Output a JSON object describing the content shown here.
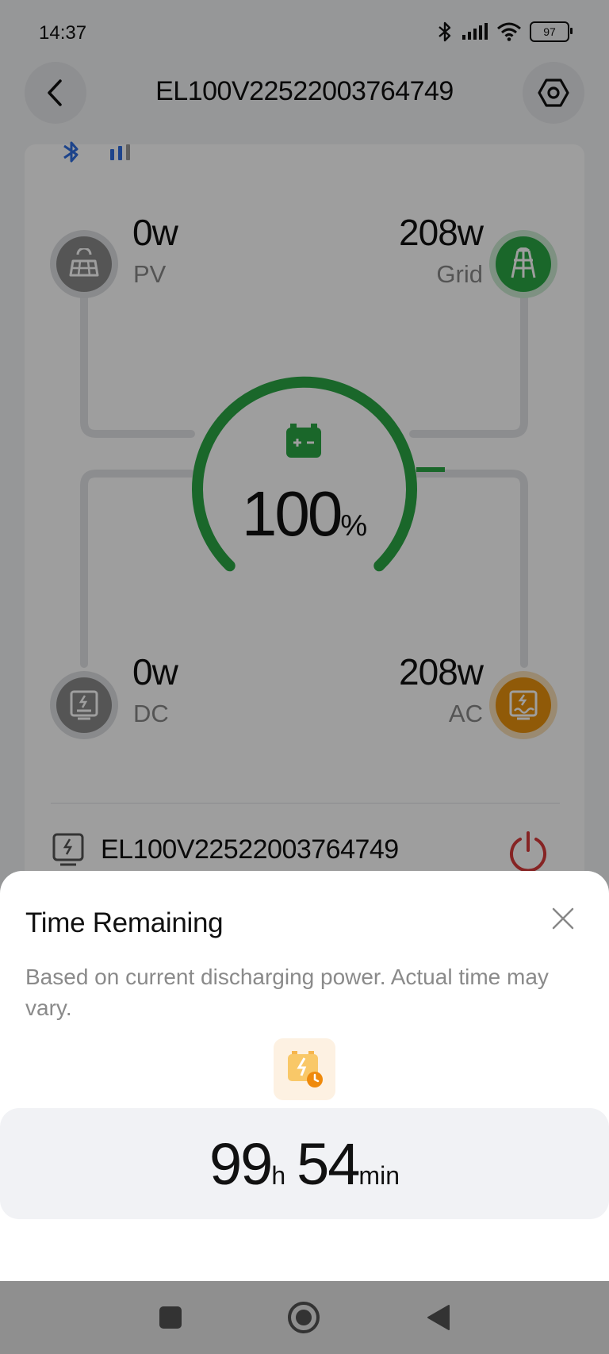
{
  "status_bar": {
    "time": "14:37",
    "battery": "97"
  },
  "header": {
    "title": "EL100V22522003764749"
  },
  "energy_flow": {
    "pv": {
      "value": "0w",
      "label": "PV"
    },
    "grid": {
      "value": "208w",
      "label": "Grid"
    },
    "dc": {
      "value": "0w",
      "label": "DC"
    },
    "ac": {
      "value": "208w",
      "label": "AC"
    },
    "battery": {
      "percent": "100",
      "unit": "%",
      "level": 1.0
    }
  },
  "device_row": {
    "name": "EL100V22522003764749"
  },
  "sheet": {
    "title": "Time Remaining",
    "description": "Based on current discharging power. Actual time may vary.",
    "hours": "99",
    "hours_unit": "h",
    "minutes": "54",
    "minutes_unit": "min"
  },
  "colors": {
    "green": "#2aa745",
    "orange": "#e8920e",
    "red": "#d83a3a",
    "blue": "#2f6fe0",
    "gray_icon": "#8a8a8a"
  }
}
